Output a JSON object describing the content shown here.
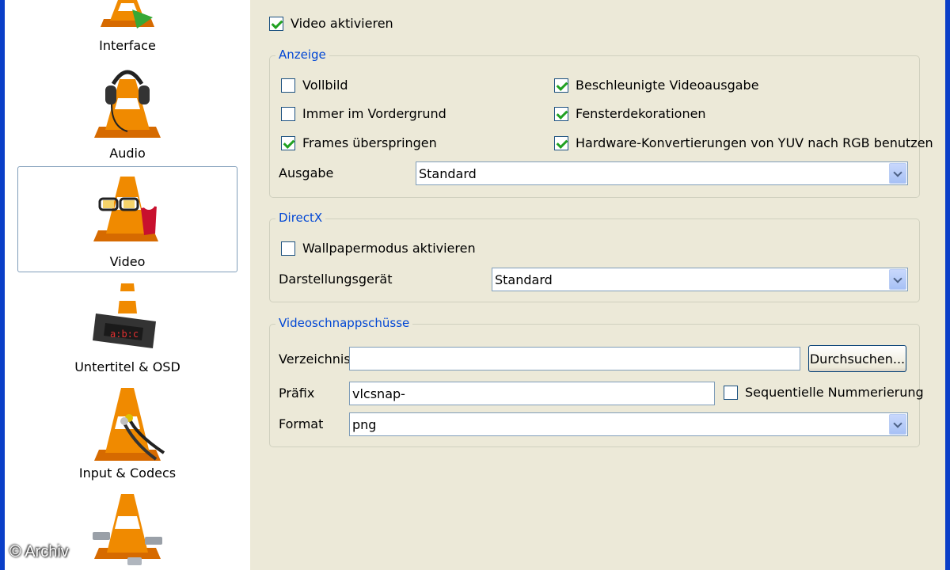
{
  "sidebar": {
    "categories": [
      {
        "label": "Interface",
        "icon": "vlc-cone-interface-icon",
        "selected": false
      },
      {
        "label": "Audio",
        "icon": "vlc-cone-headphones-icon",
        "selected": false
      },
      {
        "label": "Video",
        "icon": "vlc-cone-video-icon",
        "selected": true
      },
      {
        "label": "Untertitel & OSD",
        "icon": "vlc-cone-subtitles-icon",
        "selected": false
      },
      {
        "label": "Input & Codecs",
        "icon": "vlc-cone-codecs-icon",
        "selected": false
      },
      {
        "label": "",
        "icon": "vlc-cone-advanced-icon",
        "selected": false
      }
    ]
  },
  "video": {
    "enable_label": "Video aktivieren",
    "enable_checked": true
  },
  "anzeige": {
    "title": "Anzeige",
    "vollbild": "Vollbild",
    "vordergrund": "Immer im Vordergrund",
    "frames": "Frames überspringen",
    "beschleunigt": "Beschleunigte Videoausgabe",
    "fenster": "Fensterdekorationen",
    "hardware": "Hardware-Konvertierungen von YUV nach RGB benutzen",
    "ausgabe_label": "Ausgabe",
    "ausgabe_value": "Standard"
  },
  "directx": {
    "title": "DirectX",
    "wallpaper": "Wallpapermodus aktivieren",
    "geraet_label": "Darstellungsgerät",
    "geraet_value": "Standard"
  },
  "snapshots": {
    "title": "Videoschnappschüsse",
    "verzeichnis_label": "Verzeichnis",
    "verzeichnis_value": "",
    "browse_label": "Durchsuchen...",
    "praefix_label": "Präfix",
    "praefix_value": "vlcsnap-",
    "sequentiell": "Sequentielle Nummerierung",
    "format_label": "Format",
    "format_value": "png"
  },
  "watermark": "© Archiv",
  "colors": {
    "frame": "#0a3fc8",
    "window_bg": "#ece9d8",
    "group_title": "#0046d5",
    "checkmark": "#21a121",
    "vlc_orange": "#f08a00"
  }
}
